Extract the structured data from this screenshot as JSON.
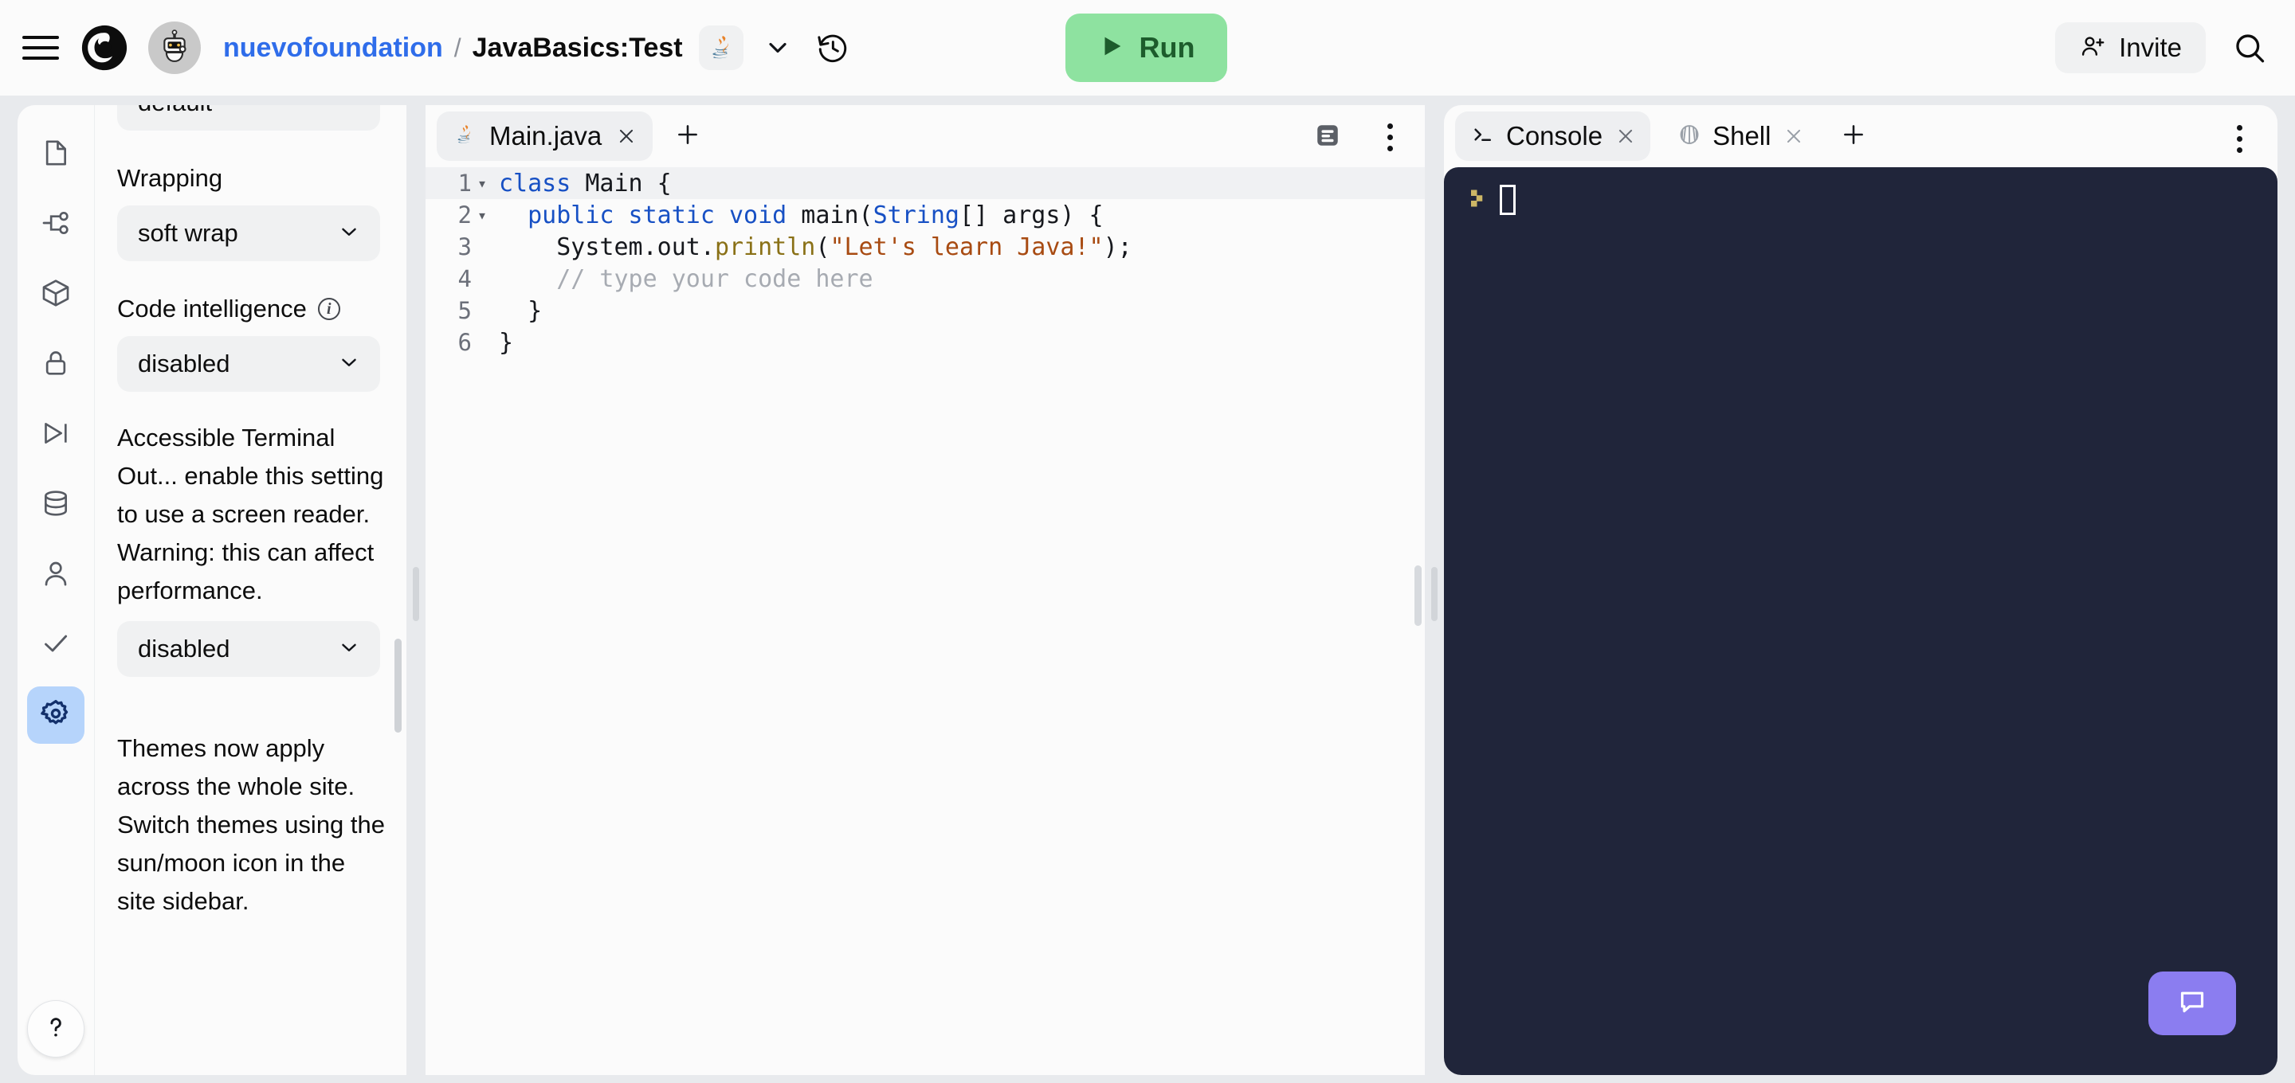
{
  "topbar": {
    "menu_icon": "hamburger-menu-icon",
    "logo_icon": "replit-logo-icon",
    "avatar_icon": "robot-avatar-icon",
    "breadcrumb": {
      "owner": "nuevofoundation",
      "separator": "/",
      "repl_name": "JavaBasics:Test"
    },
    "language_icon": "java-icon",
    "chevron_icon": "chevron-down-icon",
    "history_icon": "history-clock-icon",
    "run_label": "Run",
    "run_icon": "play-icon",
    "run_color": "#8ee2a0",
    "run_text_color": "#1d5c2c",
    "invite_label": "Invite",
    "invite_icon": "user-plus-icon",
    "search_icon": "search-icon"
  },
  "rail": {
    "items": [
      {
        "name": "files",
        "icon": "file-icon",
        "active": false
      },
      {
        "name": "version-control",
        "icon": "git-branch-icon",
        "active": false
      },
      {
        "name": "packages",
        "icon": "cube-package-icon",
        "active": false
      },
      {
        "name": "secrets",
        "icon": "lock-icon",
        "active": false
      },
      {
        "name": "deployments",
        "icon": "play-to-end-icon",
        "active": false
      },
      {
        "name": "database",
        "icon": "database-icon",
        "active": false
      },
      {
        "name": "authentication",
        "icon": "user-icon",
        "active": false
      },
      {
        "name": "checks",
        "icon": "checkmark-icon",
        "active": false
      },
      {
        "name": "settings",
        "icon": "gear-icon",
        "active": true
      }
    ],
    "active_bg": "#b6d4fb",
    "help_icon": "question-mark-icon"
  },
  "settings": {
    "theme_select": {
      "value": "default",
      "chevron": "chevron-down-icon"
    },
    "wrapping_label": "Wrapping",
    "wrapping_select": {
      "value": "soft wrap",
      "chevron": "chevron-down-icon"
    },
    "code_intel_label": "Code intelligence",
    "code_intel_info_icon": "info-icon",
    "code_intel_select": {
      "value": "disabled",
      "chevron": "chevron-down-icon"
    },
    "accessible_terminal_text": "Accessible Terminal Out... enable this setting to use a screen reader. Warning: this can affect performance.",
    "accessible_terminal_select": {
      "value": "disabled",
      "chevron": "chevron-down-icon"
    },
    "themes_note": "Themes now apply across the whole site. Switch themes using the sun/moon icon in the site sidebar."
  },
  "editor": {
    "tabs": [
      {
        "label": "Main.java",
        "icon": "java-icon",
        "close_icon": "close-icon",
        "active": true
      }
    ],
    "add_tab_icon": "plus-icon",
    "format_icon": "document-lines-icon",
    "more_icon": "more-vertical-icon",
    "lines": [
      {
        "num": "1",
        "fold": "▾",
        "current": true,
        "tokens": [
          {
            "t": "class ",
            "c": "k-kw"
          },
          {
            "t": "Main {",
            "c": "k-plain"
          }
        ]
      },
      {
        "num": "2",
        "fold": "▾",
        "current": false,
        "tokens": [
          {
            "t": "  ",
            "c": "k-plain"
          },
          {
            "t": "public static void ",
            "c": "k-kw"
          },
          {
            "t": "main(",
            "c": "k-plain"
          },
          {
            "t": "String",
            "c": "k-type"
          },
          {
            "t": "[] args) {",
            "c": "k-plain"
          }
        ]
      },
      {
        "num": "3",
        "fold": "",
        "current": false,
        "tokens": [
          {
            "t": "    System.out.",
            "c": "k-plain"
          },
          {
            "t": "println",
            "c": "k-fn"
          },
          {
            "t": "(",
            "c": "k-plain"
          },
          {
            "t": "\"Let's learn Java!\"",
            "c": "k-str"
          },
          {
            "t": ");",
            "c": "k-plain"
          }
        ]
      },
      {
        "num": "4",
        "fold": "",
        "current": false,
        "tokens": [
          {
            "t": "    // type your code here",
            "c": "k-cmt"
          }
        ]
      },
      {
        "num": "5",
        "fold": "",
        "current": false,
        "tokens": [
          {
            "t": "  }",
            "c": "k-plain"
          }
        ]
      },
      {
        "num": "6",
        "fold": "",
        "current": false,
        "tokens": [
          {
            "t": "}",
            "c": "k-plain"
          }
        ]
      }
    ]
  },
  "console": {
    "tabs": [
      {
        "label": "Console",
        "icon": "terminal-prompt-icon",
        "close_icon": "close-icon",
        "active": true
      },
      {
        "label": "Shell",
        "icon": "shell-icon",
        "close_icon": "close-icon",
        "active": false
      }
    ],
    "add_tab_icon": "plus-icon",
    "more_icon": "more-vertical-icon",
    "background": "#20253a",
    "prompt_icon": "prompt-chevron-icon",
    "prompt_color": "#cdb766",
    "cursor": "block-cursor",
    "output": ""
  },
  "chat": {
    "icon": "chat-bubble-icon",
    "color": "#8b7df0"
  }
}
